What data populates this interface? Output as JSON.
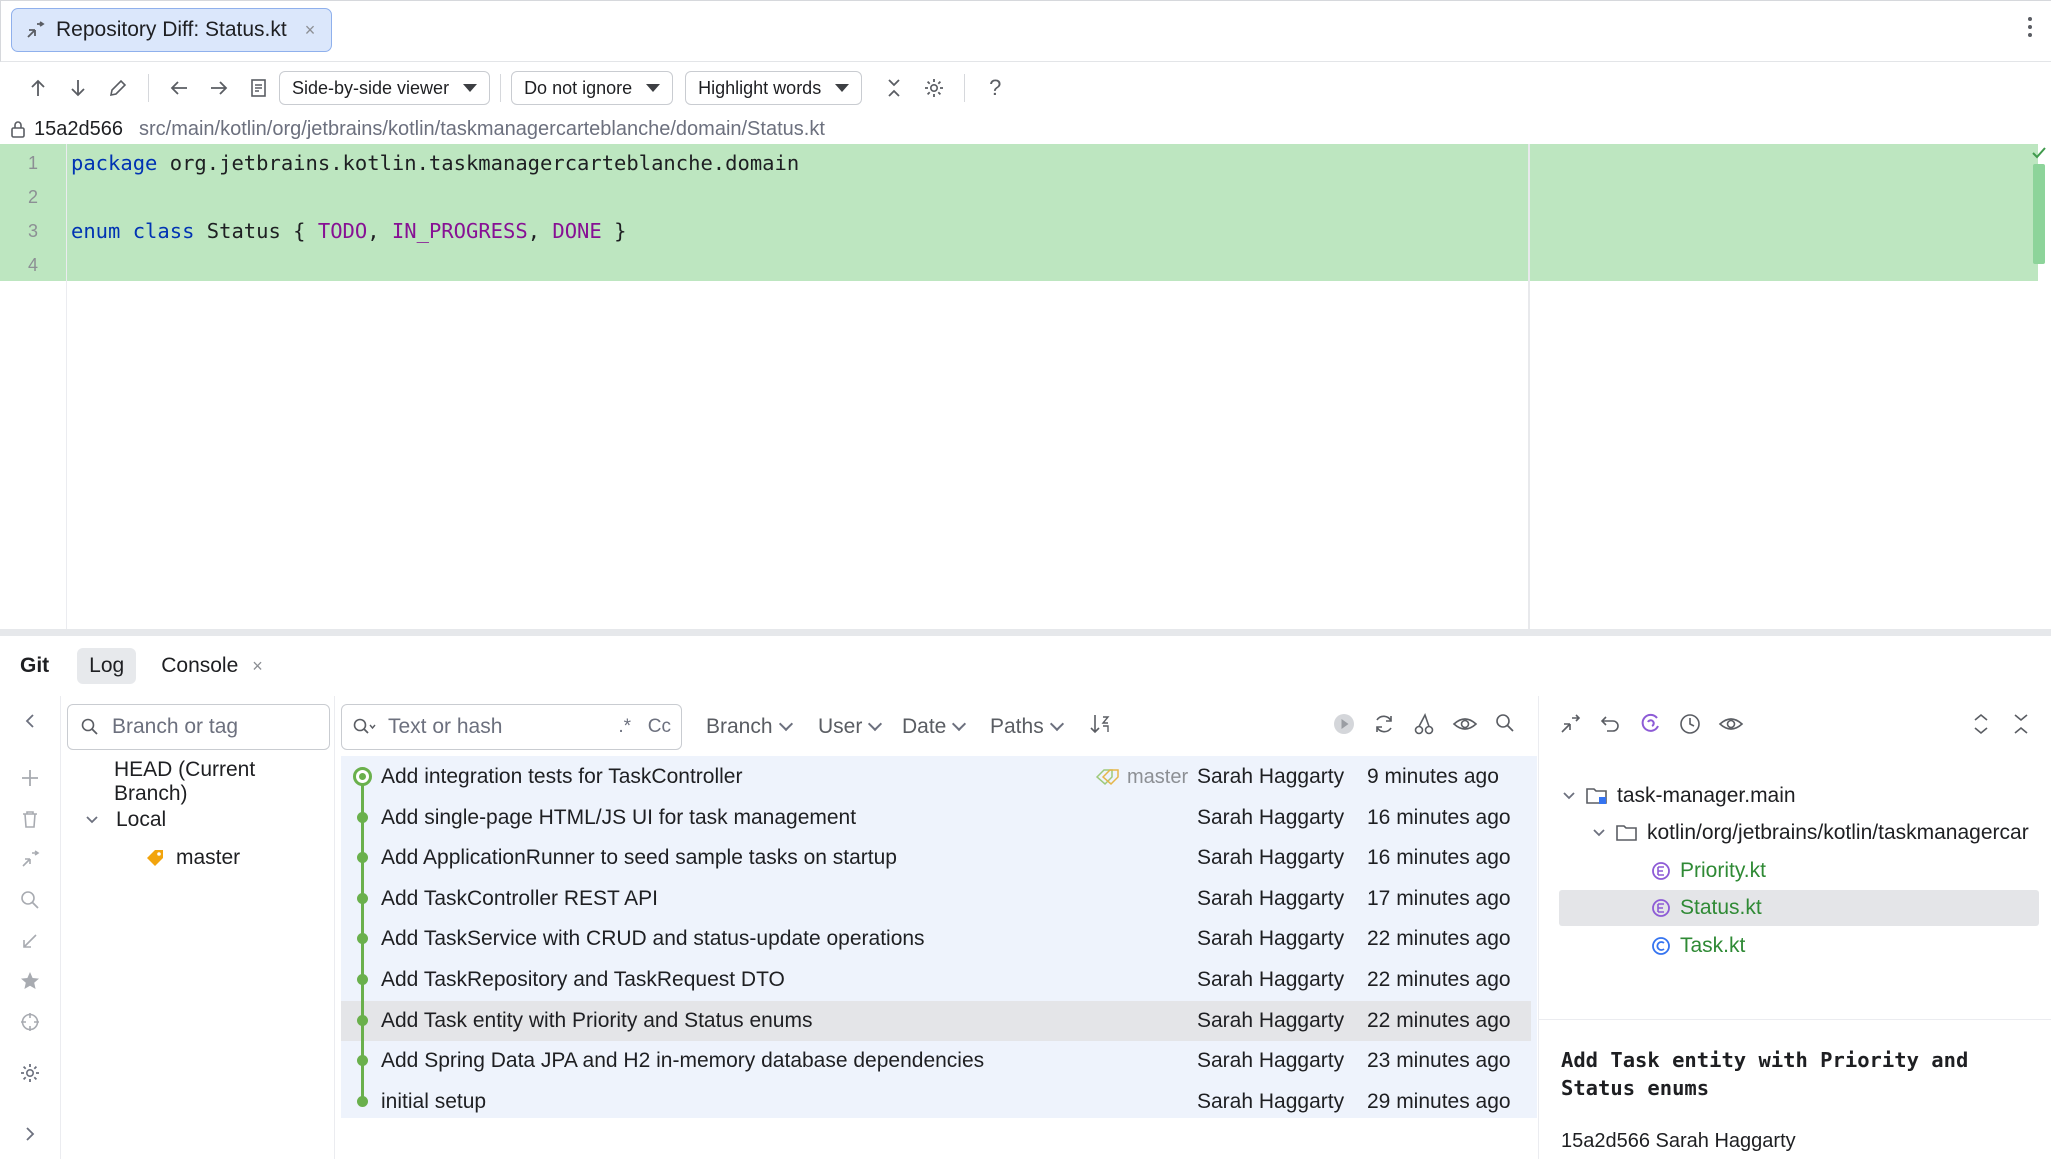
{
  "tab": {
    "title": "Repository Diff: Status.kt",
    "close": "×"
  },
  "toolbar": {
    "viewer": "Side-by-side viewer",
    "ignore": "Do not ignore",
    "highlight": "Highlight words",
    "help": "?"
  },
  "pathbar": {
    "hash": "15a2d566",
    "path": "src/main/kotlin/org/jetbrains/kotlin/taskmanagercarteblanche/domain/Status.kt"
  },
  "editor": {
    "lines": [
      {
        "num": "1",
        "tokens": [
          {
            "t": "package",
            "c": "kw"
          },
          {
            "t": " org.jetbrains.kotlin.taskmanagercarteblanche.domain",
            "c": ""
          }
        ]
      },
      {
        "num": "2",
        "tokens": []
      },
      {
        "num": "3",
        "tokens": [
          {
            "t": "enum",
            "c": "kw"
          },
          {
            "t": " ",
            "c": ""
          },
          {
            "t": "class",
            "c": "kw"
          },
          {
            "t": " Status { ",
            "c": ""
          },
          {
            "t": "TODO",
            "c": "enumc"
          },
          {
            "t": ", ",
            "c": ""
          },
          {
            "t": "IN_PROGRESS",
            "c": "enumc"
          },
          {
            "t": ", ",
            "c": ""
          },
          {
            "t": "DONE",
            "c": "enumc"
          },
          {
            "t": " }",
            "c": ""
          }
        ]
      },
      {
        "num": "4",
        "tokens": []
      }
    ]
  },
  "toolwindow": {
    "git": "Git",
    "log": "Log",
    "console": "Console",
    "console_close": "×"
  },
  "branches": {
    "search_placeholder": "Branch or tag",
    "head": "HEAD (Current Branch)",
    "local": "Local",
    "master": "master"
  },
  "log": {
    "filter_placeholder": "Text or hash",
    "regex": ".*",
    "case": "Cc",
    "filters": [
      "Branch",
      "User",
      "Date",
      "Paths"
    ],
    "commits": [
      {
        "msg": "Add integration tests for TaskController",
        "ref": "master",
        "author": "Sarah Haggarty",
        "date": "9 minutes ago"
      },
      {
        "msg": "Add single-page HTML/JS UI for task management",
        "ref": "",
        "author": "Sarah Haggarty",
        "date": "16 minutes ago"
      },
      {
        "msg": "Add ApplicationRunner to seed sample tasks on startup",
        "ref": "",
        "author": "Sarah Haggarty",
        "date": "16 minutes ago"
      },
      {
        "msg": "Add TaskController REST API",
        "ref": "",
        "author": "Sarah Haggarty",
        "date": "17 minutes ago"
      },
      {
        "msg": "Add TaskService with CRUD and status-update operations",
        "ref": "",
        "author": "Sarah Haggarty",
        "date": "22 minutes ago"
      },
      {
        "msg": "Add TaskRepository and TaskRequest DTO",
        "ref": "",
        "author": "Sarah Haggarty",
        "date": "22 minutes ago"
      },
      {
        "msg": "Add Task entity with Priority and Status enums",
        "ref": "",
        "author": "Sarah Haggarty",
        "date": "22 minutes ago",
        "selected": true
      },
      {
        "msg": "Add Spring Data JPA and H2 in-memory database dependencies",
        "ref": "",
        "author": "Sarah Haggarty",
        "date": "23 minutes ago"
      },
      {
        "msg": "initial setup",
        "ref": "",
        "author": "Sarah Haggarty",
        "date": "29 minutes ago"
      }
    ]
  },
  "changes": {
    "module": "task-manager.main",
    "package": "kotlin/org/jetbrains/kotlin/taskmanagercar",
    "files": [
      "Priority.kt",
      "Status.kt",
      "Task.kt"
    ],
    "details_title": "Add Task entity with Priority and\nStatus enums",
    "details_meta": "15a2d566 Sarah Haggarty"
  },
  "colors": {
    "added_band": "#bde6c0",
    "graph": "#6ab04c",
    "accent": "#8fb0ec"
  }
}
